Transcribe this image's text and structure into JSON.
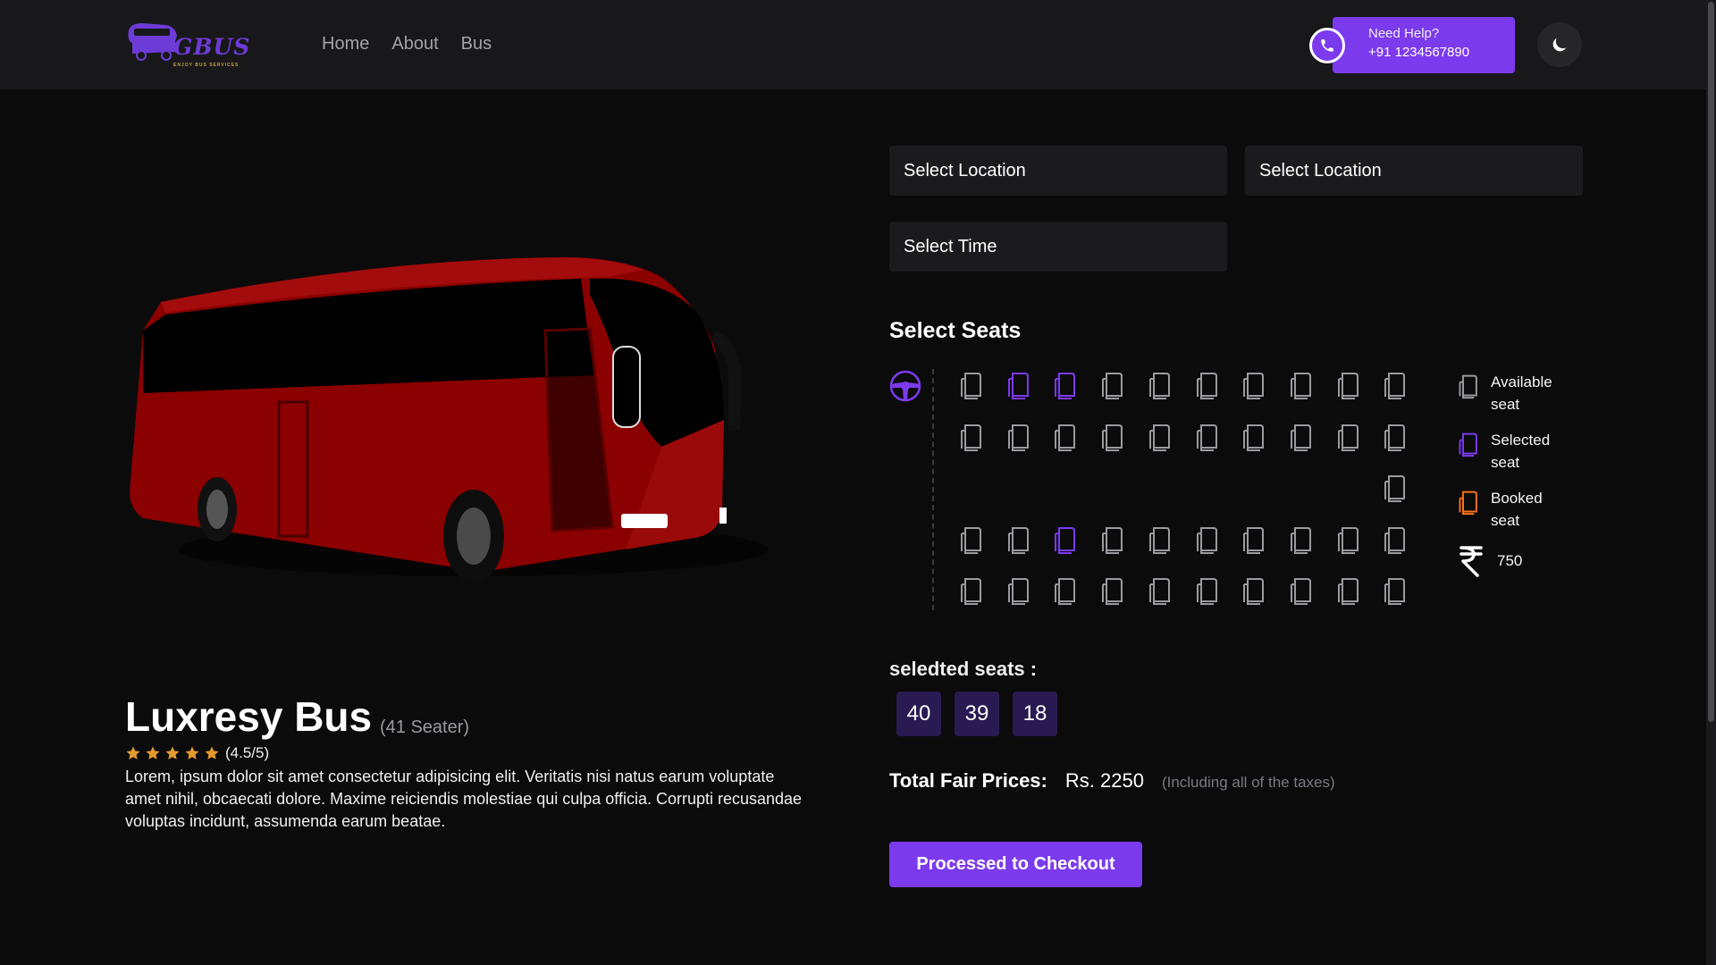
{
  "brand": {
    "name": "GBUS",
    "tagline": "ENJOY BUS SERVICES",
    "color": "#7c3aed"
  },
  "nav": {
    "links": [
      "Home",
      "About",
      "Bus"
    ],
    "help_title": "Need Help?",
    "help_phone": "+91 1234567890",
    "help_icon": "phone-icon",
    "theme_icon": "moon-icon"
  },
  "bus": {
    "name": "Luxresy Bus",
    "seater": "(41 Seater)",
    "stars": 5,
    "rating": "(4.5/5)",
    "description": "Lorem, ipsum dolor sit amet consectetur adipisicing elit. Veritatis nisi natus earum voluptate amet nihil, obcaecati dolore. Maxime reiciendis molestiae qui culpa officia. Corrupti recusandae voluptas incidunt, assumenda earum beatae."
  },
  "form": {
    "from_location": "Select Location",
    "to_location": "Select Location",
    "time": "Select Time"
  },
  "seats": {
    "title": "Select Seats",
    "rows": [
      [
        "available",
        "selected",
        "selected",
        "available",
        "available",
        "available",
        "available",
        "available",
        "available",
        "available"
      ],
      [
        "available",
        "available",
        "available",
        "available",
        "available",
        "available",
        "available",
        "available",
        "available",
        "available"
      ],
      [
        "",
        "",
        "",
        "",
        "",
        "",
        "",
        "",
        "",
        "available"
      ],
      [
        "available",
        "available",
        "selected",
        "available",
        "available",
        "available",
        "available",
        "available",
        "available",
        "available"
      ],
      [
        "available",
        "available",
        "available",
        "available",
        "available",
        "available",
        "available",
        "available",
        "available",
        "available"
      ]
    ],
    "colors": {
      "available": "#9a9a9f",
      "selected": "#7c3aed",
      "booked": "#f97316"
    }
  },
  "legend": {
    "available": "Available seat",
    "selected": "Selected seat",
    "booked": "Booked seat",
    "price": "750",
    "price_icon": "rupee-icon"
  },
  "selection": {
    "title": "seledted seats :",
    "seats": [
      "40",
      "39",
      "18"
    ]
  },
  "total": {
    "label": "Total Fair Prices:",
    "value": "Rs. 2250",
    "note": "(Including all of the taxes)"
  },
  "checkout_label": "Processed to Checkout"
}
